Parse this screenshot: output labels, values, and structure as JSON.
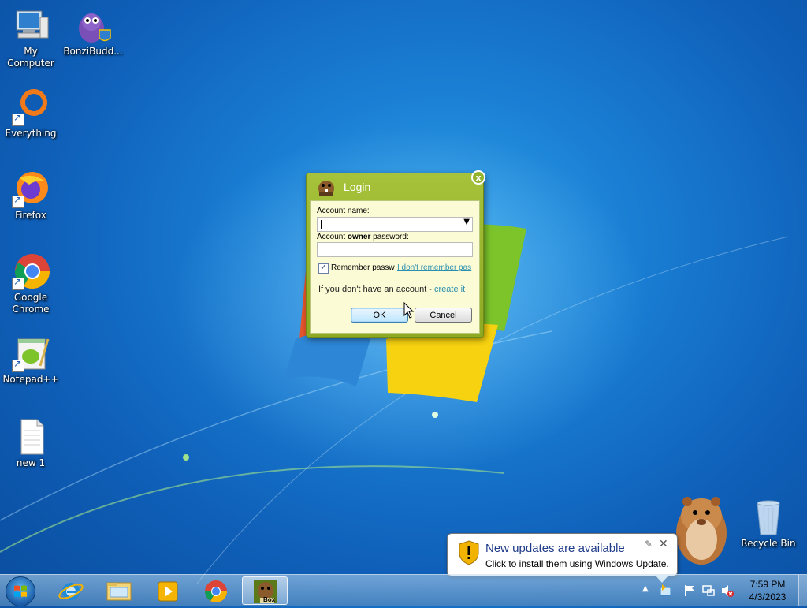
{
  "desktop": {
    "icons": [
      {
        "label": "My Computer",
        "icon": "computer-icon"
      },
      {
        "label": "BonziBudd...",
        "icon": "bonzibuddy-icon"
      },
      {
        "label": "Everything",
        "icon": "everything-search-icon"
      },
      {
        "label": "Firefox",
        "icon": "firefox-icon"
      },
      {
        "label": "Google Chrome",
        "icon": "chrome-icon"
      },
      {
        "label": "Notepad++",
        "icon": "notepadpp-icon"
      },
      {
        "label": "new 1",
        "icon": "text-file-icon"
      },
      {
        "label": "Recycle Bin",
        "icon": "recycle-bin-icon"
      }
    ]
  },
  "login_dialog": {
    "title": "Login",
    "close_label": "x",
    "account_name_label": "Account name:",
    "account_name_value": "",
    "password_label_pre": "Account ",
    "password_label_bold": "owner",
    "password_label_post": " password:",
    "password_value": "",
    "remember_label": "Remember passw",
    "remember_checked": true,
    "forgot_link": "I don't remember pas",
    "no_account_text": "If you don't have an account - ",
    "create_link": "create it",
    "ok_label": "OK",
    "cancel_label": "Cancel"
  },
  "notification": {
    "title": "New updates are available",
    "text": "Click to install them using Windows Update.",
    "icon": "warning-shield-icon"
  },
  "taskbar": {
    "pinned": [
      {
        "name": "internet-explorer-icon"
      },
      {
        "name": "file-explorer-icon"
      },
      {
        "name": "media-player-icon"
      },
      {
        "name": "chrome-icon"
      },
      {
        "name": "box-app-icon",
        "label": "Box",
        "active": true
      }
    ],
    "clock_time": "7:59 PM",
    "clock_date": "4/3/2023"
  },
  "colors": {
    "dialog_green": "#9ab52e",
    "dialog_panel": "#fbfbd6",
    "link": "#2a8fb0",
    "desktop_blue": "#1a7fd4"
  }
}
